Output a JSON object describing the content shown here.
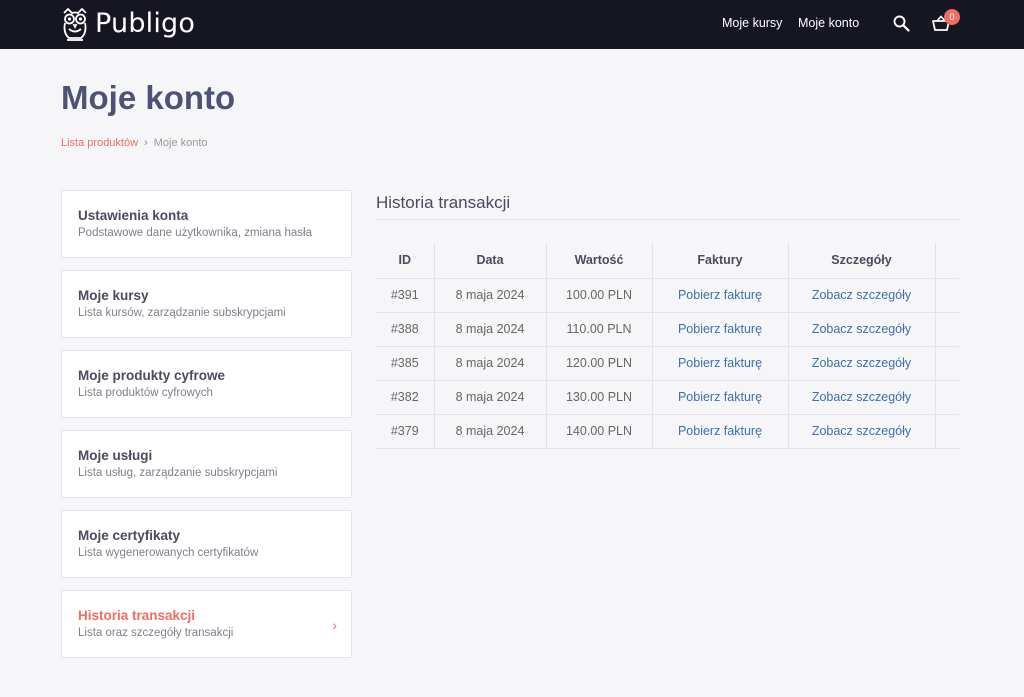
{
  "header": {
    "logo_text": "Publigo",
    "nav": [
      {
        "label": "Moje kursy"
      },
      {
        "label": "Moje konto"
      }
    ],
    "cart_count": "0",
    "background": "#151622"
  },
  "page": {
    "title": "Moje konto",
    "breadcrumb": {
      "link": "Lista produktów",
      "separator": "›",
      "current": "Moje konto"
    }
  },
  "sidebar": {
    "items": [
      {
        "title": "Ustawienia konta",
        "subtitle": "Podstawowe dane użytkownika, zmiana hasła"
      },
      {
        "title": "Moje kursy",
        "subtitle": "Lista kursów, zarządzanie subskrypcjami"
      },
      {
        "title": "Moje produkty cyfrowe",
        "subtitle": "Lista produktów cyfrowych"
      },
      {
        "title": "Moje usługi",
        "subtitle": "Lista usług, zarządzanie subskrypcjami"
      },
      {
        "title": "Moje certyfikaty",
        "subtitle": "Lista wygenerowanych certyfikatów"
      },
      {
        "title": "Historia transakcji",
        "subtitle": "Lista oraz szczegóły transakcji",
        "active": true,
        "chevron": "›"
      }
    ]
  },
  "main": {
    "section_title": "Historia transakcji",
    "table": {
      "headers": [
        "ID",
        "Data",
        "Wartość",
        "Faktury",
        "Szczegóły"
      ],
      "rows": [
        [
          "#391",
          "8 maja 2024",
          "100.00 PLN",
          "Pobierz fakturę",
          "Zobacz szczegóły"
        ],
        [
          "#388",
          "8 maja 2024",
          "110.00 PLN",
          "Pobierz fakturę",
          "Zobacz szczegóły"
        ],
        [
          "#385",
          "8 maja 2024",
          "120.00 PLN",
          "Pobierz fakturę",
          "Zobacz szczegóły"
        ],
        [
          "#382",
          "8 maja 2024",
          "130.00 PLN",
          "Pobierz fakturę",
          "Zobacz szczegóły"
        ],
        [
          "#379",
          "8 maja 2024",
          "140.00 PLN",
          "Pobierz fakturę",
          "Zobacz szczegóły"
        ]
      ]
    }
  },
  "colors": {
    "accent": "#ef6d63",
    "link": "#3e6fae",
    "title": "#4e5274"
  }
}
